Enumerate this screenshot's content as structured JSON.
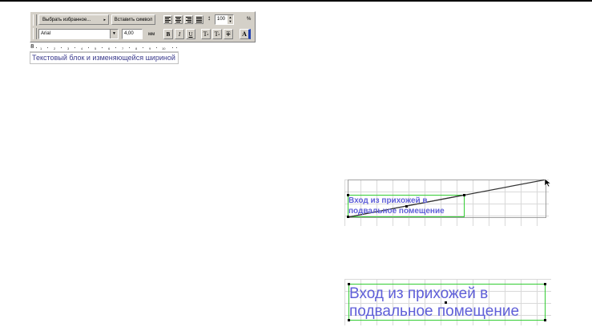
{
  "toolbar": {
    "favorites_label": "Выбрать избранное...",
    "insert_symbol_label": "Вставить символ",
    "spacing_value": "100",
    "percent_label": "%",
    "font_name": "Arial",
    "font_size": "4,00",
    "size_unit": "мм",
    "bold": "B",
    "italic": "I",
    "underline": "U",
    "superscript": "T",
    "subscript": "T",
    "strike": "T",
    "text_color": "A"
  },
  "ruler": {
    "ticks": [
      "1",
      "2",
      "3",
      "4",
      "5",
      "6",
      "7",
      "8",
      "9",
      "10"
    ]
  },
  "text_block": {
    "text": "Текстовый блок и изменяющейся шириной"
  },
  "canvas_top": {
    "label_line1": "Вход из прихожей в",
    "label_line2": "подвальное помещение"
  },
  "canvas_bottom": {
    "label_line1": "Вход из прихожей в",
    "label_line2": "подвальное помещение"
  },
  "colors": {
    "label": "#5f5fd8",
    "frame": "#33cc33",
    "toolbar_bg": "#d4d0c8"
  }
}
